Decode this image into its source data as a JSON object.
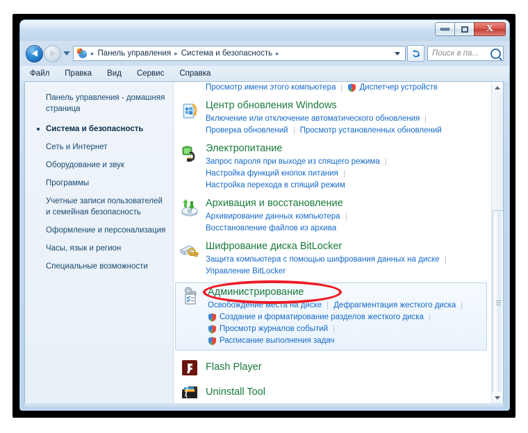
{
  "window": {
    "minimize_label": "Свернуть",
    "maximize_label": "Развернуть",
    "close_label": "X"
  },
  "address_bar": {
    "back_label": "Назад",
    "forward_label": "Вперед",
    "recent_label": "Последние страницы",
    "icon": "control-panel-icon",
    "crumbs": [
      "Панель управления",
      "Система и безопасность"
    ],
    "separator": "▸",
    "dropdown": "chevron-down-icon",
    "refresh": "refresh-icon"
  },
  "search": {
    "placeholder": "Поиск в па...",
    "icon": "search-icon"
  },
  "menu": {
    "items": [
      "Файл",
      "Правка",
      "Вид",
      "Сервис",
      "Справка"
    ]
  },
  "sidebar": {
    "home": "Панель управления - домашняя страница",
    "items": [
      {
        "label": "Система и безопасность",
        "active": true
      },
      {
        "label": "Сеть и Интернет",
        "active": false
      },
      {
        "label": "Оборудование и звук",
        "active": false
      },
      {
        "label": "Программы",
        "active": false
      },
      {
        "label": "Учетные записи пользователей и семейная безопасность",
        "active": false
      },
      {
        "label": "Оформление и персонализация",
        "active": false
      },
      {
        "label": "Часы, язык и регион",
        "active": false
      },
      {
        "label": "Специальные возможности",
        "active": false
      }
    ]
  },
  "content": {
    "partial_row": {
      "link": "Просмотр имени этого компьютера",
      "shield_link": "Диспетчер устройств"
    },
    "categories": [
      {
        "icon": "windows-update-icon",
        "title": "Центр обновления Windows",
        "boxed": false,
        "rows": [
          [
            {
              "text": "Включение или отключение автоматического обновления",
              "shield": false,
              "trailing_divider": true
            }
          ],
          [
            {
              "text": "Проверка обновлений",
              "shield": false,
              "trailing_divider": true
            },
            {
              "text": "Просмотр установленных обновлений",
              "shield": false,
              "trailing_divider": false
            }
          ]
        ]
      },
      {
        "icon": "power-icon",
        "title": "Электропитание",
        "boxed": false,
        "rows": [
          [
            {
              "text": "Запрос пароля при выходе из спящего режима",
              "shield": false,
              "trailing_divider": true
            }
          ],
          [
            {
              "text": "Настройка функций кнопок питания",
              "shield": false,
              "trailing_divider": true
            }
          ],
          [
            {
              "text": "Настройка перехода в спящий режим",
              "shield": false,
              "trailing_divider": false
            }
          ]
        ]
      },
      {
        "icon": "backup-restore-icon",
        "title": "Архивация и восстановление",
        "boxed": false,
        "rows": [
          [
            {
              "text": "Архивирование данных компьютера",
              "shield": false,
              "trailing_divider": true
            }
          ],
          [
            {
              "text": "Восстановление файлов из архива",
              "shield": false,
              "trailing_divider": false
            }
          ]
        ]
      },
      {
        "icon": "bitlocker-icon",
        "title": "Шифрование диска BitLocker",
        "boxed": false,
        "rows": [
          [
            {
              "text": "Защита компьютера с помощью шифрования данных на диске",
              "shield": false,
              "trailing_divider": true
            }
          ],
          [
            {
              "text": "Управление BitLocker",
              "shield": false,
              "trailing_divider": false
            }
          ]
        ]
      },
      {
        "icon": "administrative-tools-icon",
        "title": "Администрирование",
        "boxed": true,
        "highlighted": true,
        "rows": [
          [
            {
              "text": "Освобождение места на диске",
              "shield": false,
              "trailing_divider": true
            },
            {
              "text": "Дефрагментация жесткого диска",
              "shield": false,
              "trailing_divider": true
            }
          ],
          [
            {
              "text": "Создание и форматирование разделов жесткого диска",
              "shield": true,
              "trailing_divider": true
            }
          ],
          [
            {
              "text": "Просмотр журналов событий",
              "shield": true,
              "trailing_divider": true
            }
          ],
          [
            {
              "text": "Расписание выполнения задач",
              "shield": true,
              "trailing_divider": false
            }
          ]
        ]
      }
    ],
    "apps": [
      {
        "icon": "flash-player-icon",
        "title": "Flash Player"
      },
      {
        "icon": "uninstall-tool-icon",
        "title": "Uninstall Tool"
      }
    ]
  },
  "scrollbar": {
    "up_arrow": "scroll-up-icon",
    "down_arrow": "scroll-down-icon",
    "thumb": "scroll-thumb"
  },
  "annotation": {
    "highlight_color": "#ee1b24",
    "target": "Администрирование"
  },
  "colors": {
    "category_title": "#1a7a3c",
    "link": "#1569c7",
    "sidebar_text": "#17496f",
    "titlebar": "#c3d8ee"
  }
}
